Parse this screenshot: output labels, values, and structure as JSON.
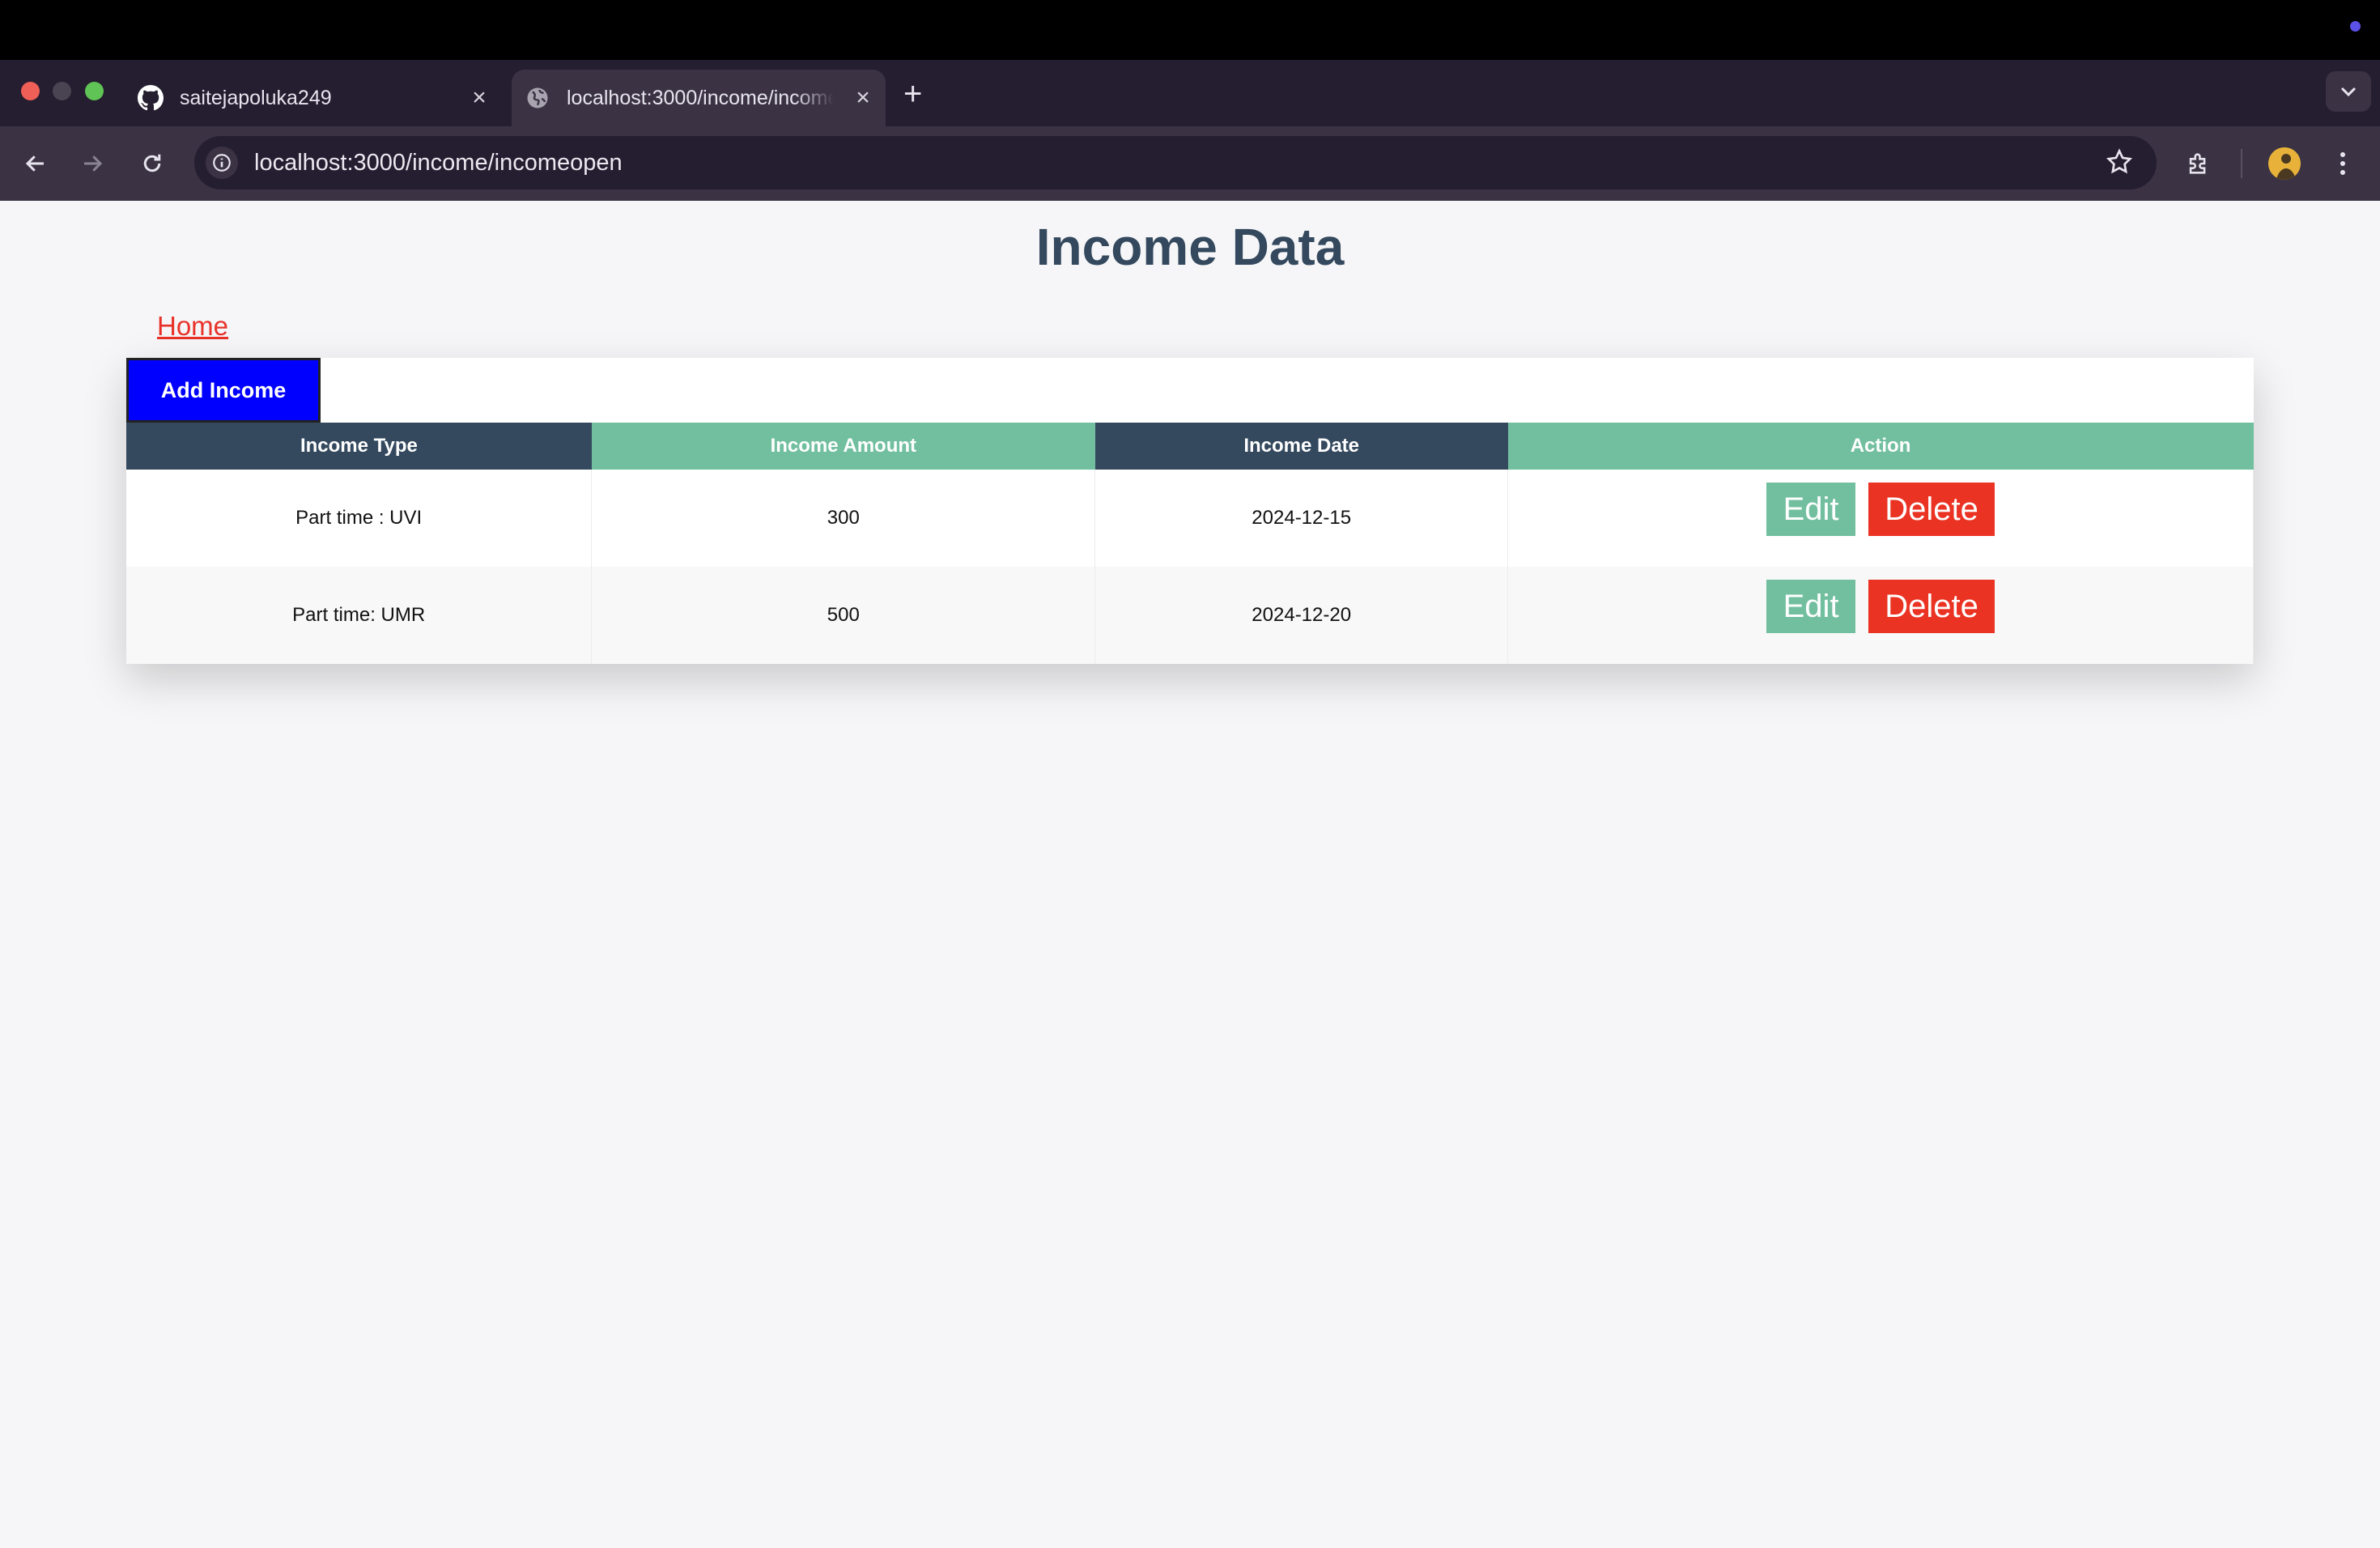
{
  "browser": {
    "tabs": [
      {
        "title": "saitejapoluka249",
        "icon": "github-icon"
      },
      {
        "title": "localhost:3000/income/incomeopen",
        "icon": "globe-icon"
      }
    ],
    "close_glyph": "×",
    "new_tab_glyph": "+",
    "url": "localhost:3000/income/incomeopen",
    "colors": {
      "tab_strip": "#251d30",
      "toolbar": "#3b3344",
      "accent_dot": "#5b50e8"
    }
  },
  "page": {
    "title": "Income Data",
    "home_link": "Home",
    "add_button": "Add Income",
    "table": {
      "headers": [
        "Income Type",
        "Income Amount",
        "Income Date",
        "Action"
      ],
      "rows": [
        {
          "type": "Part time : UVI",
          "amount": "300",
          "date": "2024-12-15"
        },
        {
          "type": "Part time: UMR",
          "amount": "500",
          "date": "2024-12-20"
        }
      ],
      "edit_label": "Edit",
      "delete_label": "Delete"
    },
    "colors": {
      "title": "#34495e",
      "link": "#e8322a",
      "add_button": "#0000ff",
      "header_dark": "#34495e",
      "header_green": "#72bfa0",
      "edit": "#72bfa0",
      "delete": "#ea3323"
    }
  }
}
